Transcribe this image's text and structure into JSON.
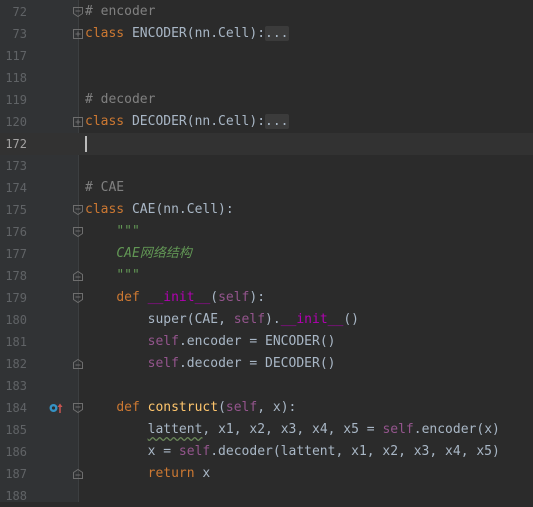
{
  "editor": {
    "lines": [
      {
        "num": "72",
        "fold": "open",
        "tokens": [
          {
            "t": "# encoder",
            "c": "comment"
          }
        ]
      },
      {
        "num": "73",
        "fold": "collapsed",
        "tokens": [
          {
            "t": "class ",
            "c": "kw"
          },
          {
            "t": "ENCODER(nn.Cell):",
            "c": "plain"
          },
          {
            "t": "...",
            "c": "fold"
          }
        ]
      },
      {
        "num": "117",
        "fold": "",
        "tokens": []
      },
      {
        "num": "118",
        "fold": "",
        "tokens": []
      },
      {
        "num": "119",
        "fold": "",
        "tokens": [
          {
            "t": "# decoder",
            "c": "comment"
          }
        ]
      },
      {
        "num": "120",
        "fold": "collapsed",
        "tokens": [
          {
            "t": "class ",
            "c": "kw"
          },
          {
            "t": "DECODER(nn.Cell):",
            "c": "plain"
          },
          {
            "t": "...",
            "c": "fold"
          }
        ]
      },
      {
        "num": "172",
        "fold": "",
        "current": true,
        "caret": true,
        "tokens": []
      },
      {
        "num": "173",
        "fold": "",
        "tokens": []
      },
      {
        "num": "174",
        "fold": "",
        "tokens": [
          {
            "t": "# CAE",
            "c": "comment"
          }
        ]
      },
      {
        "num": "175",
        "fold": "open",
        "tokens": [
          {
            "t": "class ",
            "c": "kw"
          },
          {
            "t": "CAE(nn.Cell):",
            "c": "plain"
          }
        ]
      },
      {
        "num": "176",
        "fold": "open",
        "tokens": [
          {
            "t": "    ",
            "c": "plain"
          },
          {
            "t": "\"\"\"",
            "c": "doc"
          }
        ]
      },
      {
        "num": "177",
        "fold": "",
        "tokens": [
          {
            "t": "    ",
            "c": "plain"
          },
          {
            "t": "CAE网络结构",
            "c": "doc"
          }
        ]
      },
      {
        "num": "178",
        "fold": "end",
        "tokens": [
          {
            "t": "    ",
            "c": "plain"
          },
          {
            "t": "\"\"\"",
            "c": "doc"
          }
        ]
      },
      {
        "num": "179",
        "fold": "open",
        "tokens": [
          {
            "t": "    ",
            "c": "plain"
          },
          {
            "t": "def ",
            "c": "kw"
          },
          {
            "t": "__init__",
            "c": "magic"
          },
          {
            "t": "(",
            "c": "plain"
          },
          {
            "t": "self",
            "c": "self"
          },
          {
            "t": "):",
            "c": "plain"
          }
        ]
      },
      {
        "num": "180",
        "fold": "",
        "tokens": [
          {
            "t": "        ",
            "c": "plain"
          },
          {
            "t": "super",
            "c": "plain"
          },
          {
            "t": "(CAE, ",
            "c": "plain"
          },
          {
            "t": "self",
            "c": "self"
          },
          {
            "t": ").",
            "c": "plain"
          },
          {
            "t": "__init__",
            "c": "magic"
          },
          {
            "t": "()",
            "c": "plain"
          }
        ]
      },
      {
        "num": "181",
        "fold": "",
        "tokens": [
          {
            "t": "        ",
            "c": "plain"
          },
          {
            "t": "self",
            "c": "self"
          },
          {
            "t": ".encoder = ENCODER()",
            "c": "plain"
          }
        ]
      },
      {
        "num": "182",
        "fold": "end",
        "tokens": [
          {
            "t": "        ",
            "c": "plain"
          },
          {
            "t": "self",
            "c": "self"
          },
          {
            "t": ".decoder = DECODER()",
            "c": "plain"
          }
        ]
      },
      {
        "num": "183",
        "fold": "",
        "tokens": []
      },
      {
        "num": "184",
        "fold": "open",
        "icon": "override-breakpoint-icon",
        "tokens": [
          {
            "t": "    ",
            "c": "plain"
          },
          {
            "t": "def ",
            "c": "kw"
          },
          {
            "t": "construct",
            "c": "fn"
          },
          {
            "t": "(",
            "c": "plain"
          },
          {
            "t": "self",
            "c": "self"
          },
          {
            "t": ", x):",
            "c": "plain"
          }
        ]
      },
      {
        "num": "185",
        "fold": "",
        "tokens": [
          {
            "t": "        ",
            "c": "plain"
          },
          {
            "t": "lattent",
            "c": "warn"
          },
          {
            "t": ", x1, x2, x3, x4, x5 = ",
            "c": "plain"
          },
          {
            "t": "self",
            "c": "self"
          },
          {
            "t": ".encoder(x)",
            "c": "plain"
          }
        ]
      },
      {
        "num": "186",
        "fold": "",
        "tokens": [
          {
            "t": "        x = ",
            "c": "plain"
          },
          {
            "t": "self",
            "c": "self"
          },
          {
            "t": ".decoder(lattent, x1, x2, x3, x4, x5)",
            "c": "plain"
          }
        ]
      },
      {
        "num": "187",
        "fold": "end",
        "tokens": [
          {
            "t": "        ",
            "c": "plain"
          },
          {
            "t": "return ",
            "c": "kw"
          },
          {
            "t": "x",
            "c": "plain"
          }
        ]
      },
      {
        "num": "188",
        "fold": "",
        "tokens": []
      }
    ]
  },
  "colors": {
    "background": "#2b2b2b",
    "gutter": "#313335",
    "keyword": "#cc7832",
    "comment": "#808080",
    "docstring": "#629755",
    "self": "#94558d",
    "function": "#ffc66d",
    "magic": "#b200b2",
    "text": "#a9b7c6"
  }
}
